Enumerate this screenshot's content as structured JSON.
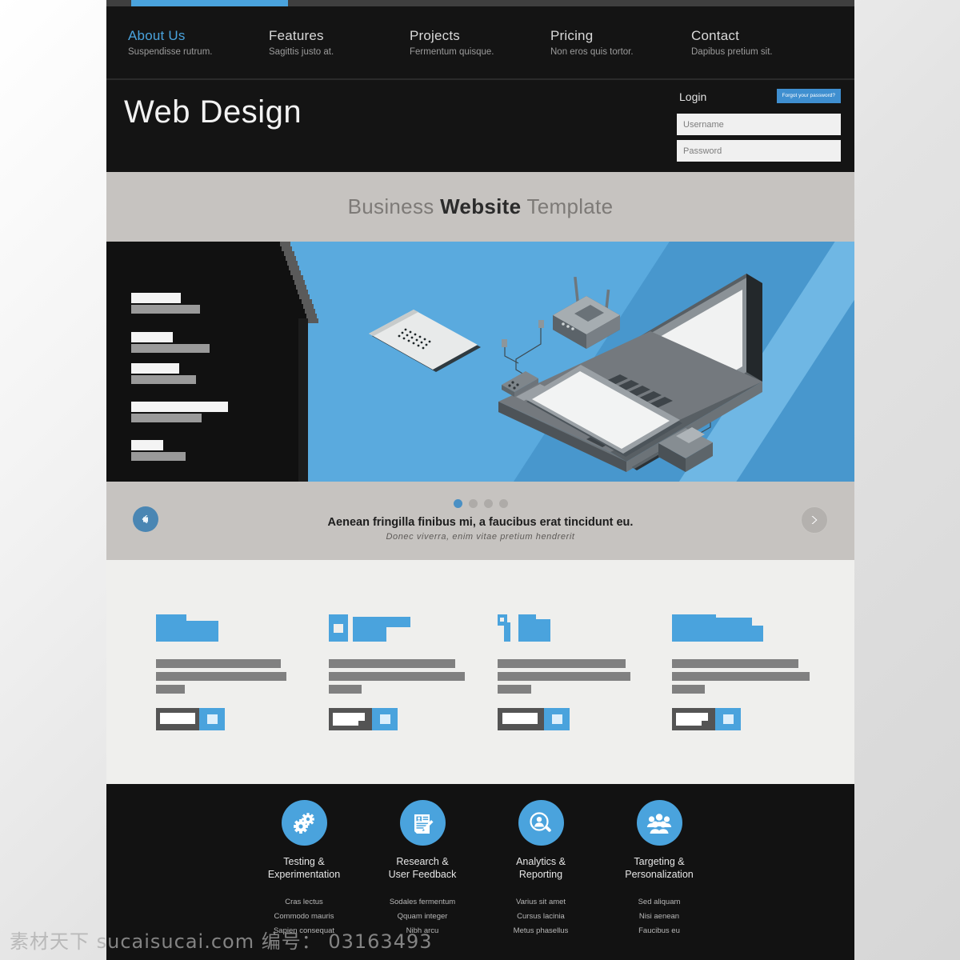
{
  "browser_strip": {
    "active_tab_color": "#4aa3dd"
  },
  "nav": {
    "items": [
      {
        "title": "About Us",
        "sub": "Suspendisse rutrum.",
        "active": true
      },
      {
        "title": "Features",
        "sub": "Sagittis justo at.",
        "active": false
      },
      {
        "title": "Projects",
        "sub": "Fermentum quisque.",
        "active": false
      },
      {
        "title": "Pricing",
        "sub": "Non eros quis tortor.",
        "active": false
      },
      {
        "title": "Contact",
        "sub": "Dapibus pretium sit.",
        "active": false
      }
    ]
  },
  "header": {
    "logo": "Web Design",
    "login": {
      "title": "Login",
      "forgot_label": "Forgot your password?",
      "username_placeholder": "Username",
      "username_value": "",
      "password_placeholder": "Password",
      "password_value": ""
    }
  },
  "tagline": {
    "prefix": "Business ",
    "emphasis": "Website",
    "suffix": " Template"
  },
  "slider": {
    "caption_main": "Aenean fringilla finibus mi, a faucibus erat tincidunt eu.",
    "caption_sub": "Donec viverra, enim vitae pretium hendrerit",
    "dots": [
      {
        "active": true
      },
      {
        "active": false
      },
      {
        "active": false
      },
      {
        "active": false
      }
    ],
    "prev_label": "Previous slide",
    "next_label": "Next slide",
    "panel_items": [
      {
        "heading_w": 62,
        "sub_w": 172
      },
      {
        "heading_w": 103,
        "sub_w": 196
      },
      {
        "heading_w": 92,
        "sub_w": 163
      },
      {
        "heading_w": 196,
        "sub_w": 131
      },
      {
        "heading_w": 75,
        "sub_w": 110
      }
    ]
  },
  "features": {
    "columns": [
      {
        "shape": "folder-block",
        "bars": [
          162,
          177,
          50
        ],
        "button_w": 66
      },
      {
        "shape": "square-and-block",
        "bars": [
          160,
          172,
          42
        ],
        "button_w": 56
      },
      {
        "shape": "key-and-block",
        "bars": [
          164,
          170,
          43
        ],
        "button_w": 62
      },
      {
        "shape": "wide-folder",
        "bars": [
          160,
          175,
          42
        ],
        "button_w": 58
      }
    ]
  },
  "footer": {
    "columns": [
      {
        "icon": "gears-icon",
        "title_line1": "Testing &",
        "title_line2": "Experimentation",
        "links": [
          "Cras lectus",
          "Commodo mauris",
          "Sapien consequat"
        ]
      },
      {
        "icon": "document-pen-icon",
        "title_line1": "Research &",
        "title_line2": "User Feedback",
        "links": [
          "Sodales fermentum",
          "Qquam integer",
          "Nibh arcu"
        ]
      },
      {
        "icon": "person-search-icon",
        "title_line1": "Analytics &",
        "title_line2": "Reporting",
        "links": [
          "Varius sit amet",
          "Cursus lacinia",
          "Metus phasellus"
        ]
      },
      {
        "icon": "people-group-icon",
        "title_line1": "Targeting &",
        "title_line2": "Personalization",
        "links": [
          "Sed aliquam",
          "Nisi aenean",
          "Faucibus eu"
        ]
      }
    ]
  },
  "watermark": {
    "text": "素材天下 sucaisucai.com 编号： 03163493"
  },
  "colors": {
    "accent_blue": "#4aa3dd",
    "hero_blue": "#5aaade",
    "dark": "#141414",
    "band_gray": "#c6c3c0",
    "content_gray": "#efefed"
  }
}
